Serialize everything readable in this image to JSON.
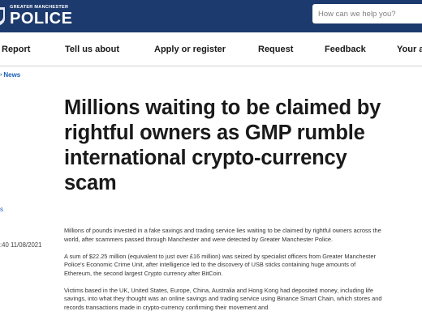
{
  "header": {
    "logo_small": "GREATER MANCHESTER",
    "logo_big": "POLICE",
    "search_placeholder": "How can we help you?"
  },
  "nav": {
    "items": [
      "Report",
      "Tell us about",
      "Apply or register",
      "Request",
      "Feedback",
      "Your ar"
    ]
  },
  "breadcrumb": {
    "label": "News"
  },
  "article": {
    "title": "Millions waiting to be claimed by rightful owners as GMP rumble international crypto-currency scam",
    "meta_fragment": "s",
    "date_fragment": ":40 11/08/2021",
    "paragraphs": [
      "Millions of pounds invested in a fake savings and trading service lies waiting to be claimed by rightful owners across the world, after scammers passed through Manchester and were detected by Greater Manchester Police.",
      "A sum of $22.25 million (equivalent to just over £16 million) was seized by specialist officers from Greater Manchester Police's Economic Crime Unit, after intelligence led to the discovery of USB sticks containing huge amounts of Ethereum, the second largest Crypto currency after BitCoin.",
      "Victims based in the UK, United States, Europe, China, Australia and Hong Kong had deposited money, including life savings, into what they thought was an online savings and trading service using Binance Smart Chain, which stores and records transactions made in crypto-currency confirming their movement and"
    ]
  },
  "colors": {
    "header_bg": "#1d3a6e",
    "link": "#1d5fb5"
  }
}
